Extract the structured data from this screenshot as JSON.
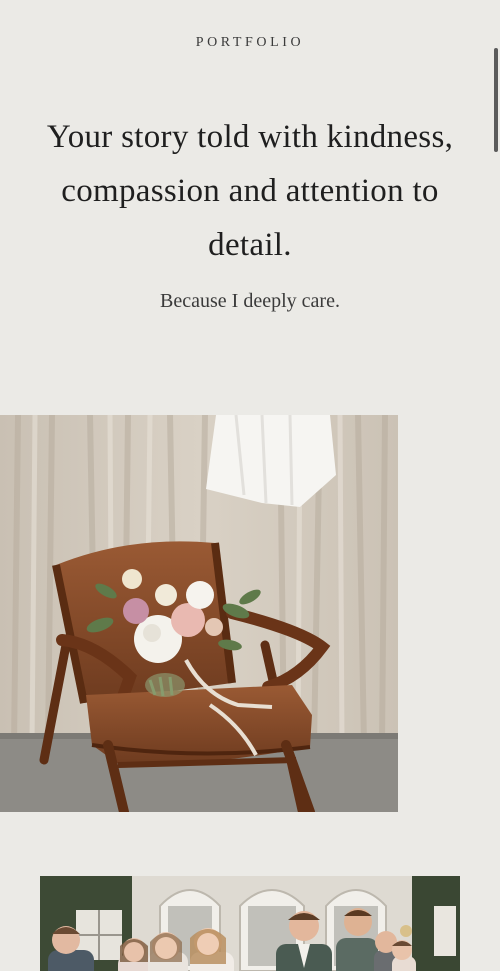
{
  "page": {
    "eyebrow": "PORTFOLIO",
    "headline": "Your story told with kindness, compassion and attention to detail.",
    "subline": "Because I deeply care."
  },
  "images": [
    {
      "name": "chair-bouquet-photo",
      "alt": ""
    },
    {
      "name": "wedding-party-photo",
      "alt": ""
    }
  ],
  "colors": {
    "background": "#ebeae6",
    "text": "#1f1f1f",
    "leather": "#8a4e2c",
    "wood": "#6a3418"
  }
}
